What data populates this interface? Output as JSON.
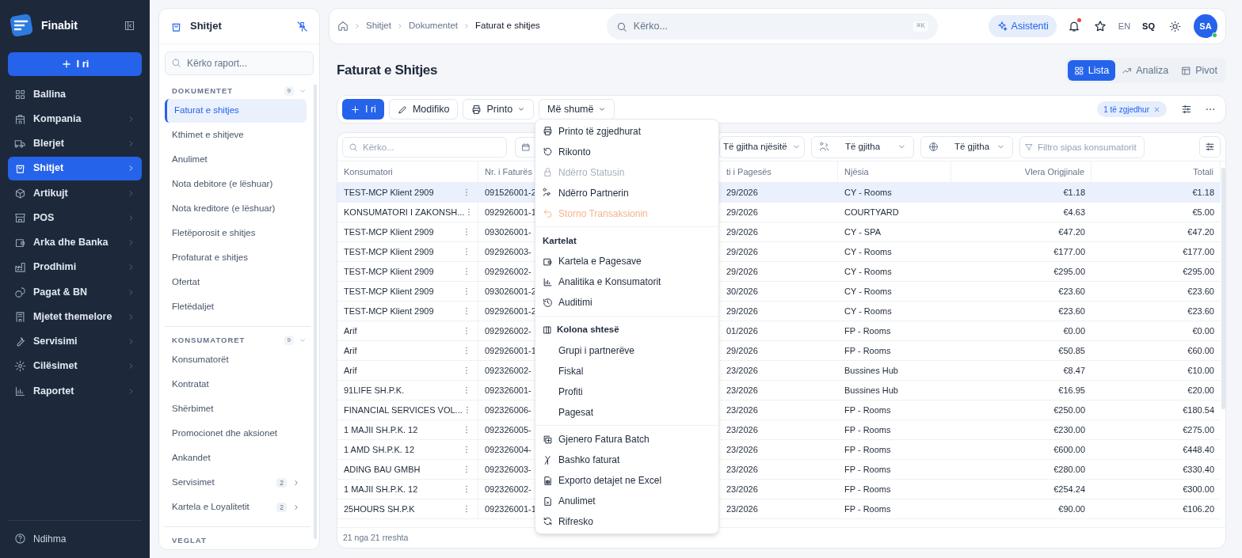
{
  "app": {
    "name": "Finabit",
    "new_button": "I ri",
    "help": "Ndihma"
  },
  "sidebar": {
    "items": [
      {
        "label": "Ballina",
        "has_children": false,
        "selected": false
      },
      {
        "label": "Kompania",
        "has_children": true,
        "selected": false
      },
      {
        "label": "Blerjet",
        "has_children": true,
        "selected": false
      },
      {
        "label": "Shitjet",
        "has_children": true,
        "selected": true
      },
      {
        "label": "Artikujt",
        "has_children": true,
        "selected": false
      },
      {
        "label": "POS",
        "has_children": true,
        "selected": false
      },
      {
        "label": "Arka dhe Banka",
        "has_children": true,
        "selected": false
      },
      {
        "label": "Prodhimi",
        "has_children": true,
        "selected": false
      },
      {
        "label": "Pagat & BN",
        "has_children": true,
        "selected": false
      },
      {
        "label": "Mjetet themelore",
        "has_children": true,
        "selected": false
      },
      {
        "label": "Servisimi",
        "has_children": true,
        "selected": false
      },
      {
        "label": "Cilësimet",
        "has_children": true,
        "selected": false
      },
      {
        "label": "Raportet",
        "has_children": true,
        "selected": false
      }
    ]
  },
  "panel": {
    "title": "Shitjet",
    "search": {
      "placeholder": "Kërko raport..."
    },
    "sections": [
      {
        "title": "DOKUMENTET",
        "count": "9",
        "expanded": true,
        "items": [
          {
            "label": "Faturat e shitjes",
            "selected": true
          },
          {
            "label": "Kthimet e shitjeve",
            "selected": false
          },
          {
            "label": "Anulimet",
            "selected": false
          },
          {
            "label": "Nota debitore (e lëshuar)",
            "selected": false
          },
          {
            "label": "Nota kreditore (e lëshuar)",
            "selected": false
          },
          {
            "label": "Fletëporosit e shitjes",
            "selected": false
          },
          {
            "label": "Profaturat e shitjes",
            "selected": false
          },
          {
            "label": "Ofertat",
            "selected": false
          },
          {
            "label": "Fletëdaljet",
            "selected": false
          }
        ]
      },
      {
        "title": "KONSUMATORET",
        "count": "9",
        "expanded": true,
        "items": [
          {
            "label": "Konsumatorët",
            "selected": false
          },
          {
            "label": "Kontratat",
            "selected": false
          },
          {
            "label": "Shërbimet",
            "selected": false
          },
          {
            "label": "Promocionet dhe aksionet",
            "selected": false
          },
          {
            "label": "Ankandet",
            "selected": false
          },
          {
            "label": "Servisimet",
            "selected": false,
            "count": "2"
          },
          {
            "label": "Kartela e Loyalitetit",
            "selected": false,
            "count": "2"
          }
        ]
      },
      {
        "title": "VEGLAT"
      }
    ]
  },
  "topbar": {
    "breadcrumb": [
      "Shitjet",
      "Dokumentet",
      "Faturat e shitjes"
    ],
    "search": {
      "placeholder": "Kërko...",
      "shortcut": "⌘K"
    },
    "assistant": "Asistenti",
    "notifications_unread": true,
    "languages": [
      {
        "label": "EN",
        "selected": false
      },
      {
        "label": "SQ",
        "selected": true
      }
    ],
    "user": {
      "initials": "SA",
      "online": true
    }
  },
  "page": {
    "title": "Faturat e Shitjes",
    "views": [
      {
        "label": "Lista",
        "selected": true
      },
      {
        "label": "Analiza",
        "selected": false
      },
      {
        "label": "Pivot",
        "selected": false
      }
    ]
  },
  "toolbar": {
    "buttons": [
      {
        "label": "I ri",
        "kind": "primary"
      },
      {
        "label": "Modifiko",
        "kind": "edit"
      },
      {
        "label": "Printo",
        "kind": "print"
      },
      {
        "label": "Më shumë",
        "kind": "more"
      }
    ],
    "selection_chip": "1 të zgjedhur"
  },
  "filters": {
    "search_placeholder": "Kërko...",
    "unit": "Të gjitha njësitë",
    "group": "Të gjitha",
    "region": "Të gjitha",
    "customer_placeholder": "Filtro sipas konsumatorit"
  },
  "table": {
    "columns": [
      "Konsumatori",
      "Nr. i Faturës",
      "ti i Pagesës",
      "Njësia",
      "Vlera Origjinale",
      "Totali"
    ],
    "rows": [
      {
        "selected": true,
        "cells": [
          "TEST-MCP Klient 2909",
          "091526001-2",
          "29/2026",
          "CY - Rooms",
          "€1.18",
          "€1.18"
        ]
      },
      {
        "selected": false,
        "cells": [
          "KONSUMATORI I ZAKONSH...",
          "092926001-1",
          "29/2026",
          "COURTYARD",
          "€4.63",
          "€5.00"
        ]
      },
      {
        "selected": false,
        "cells": [
          "TEST-MCP Klient 2909",
          "093026001-",
          "29/2026",
          "CY - SPA",
          "€47.20",
          "€47.20"
        ]
      },
      {
        "selected": false,
        "cells": [
          "TEST-MCP Klient 2909",
          "092926003-",
          "29/2026",
          "CY - Rooms",
          "€177.00",
          "€177.00"
        ]
      },
      {
        "selected": false,
        "cells": [
          "TEST-MCP Klient 2909",
          "092926002-",
          "29/2026",
          "CY - Rooms",
          "€295.00",
          "€295.00"
        ]
      },
      {
        "selected": false,
        "cells": [
          "TEST-MCP Klient 2909",
          "093026001-2",
          "30/2026",
          "CY - Rooms",
          "€23.60",
          "€23.60"
        ]
      },
      {
        "selected": false,
        "cells": [
          "TEST-MCP Klient 2909",
          "092926001-2",
          "29/2026",
          "CY - Rooms",
          "€23.60",
          "€23.60"
        ]
      },
      {
        "selected": false,
        "cells": [
          "Arif",
          "092926002-",
          "01/2026",
          "FP - Rooms",
          "€0.00",
          "€0.00"
        ]
      },
      {
        "selected": false,
        "cells": [
          "Arif",
          "092926001-1",
          "29/2026",
          "FP - Rooms",
          "€50.85",
          "€60.00"
        ]
      },
      {
        "selected": false,
        "cells": [
          "Arif",
          "092326002-",
          "23/2026",
          "Bussines Hub",
          "€8.47",
          "€10.00"
        ]
      },
      {
        "selected": false,
        "cells": [
          "91LIFE SH.P.K.",
          "092326001-",
          "23/2026",
          "Bussines Hub",
          "€16.95",
          "€20.00"
        ]
      },
      {
        "selected": false,
        "cells": [
          "FINANCIAL SERVICES VOL...",
          "092326006-",
          "23/2026",
          "FP - Rooms",
          "€250.00",
          "€180.54"
        ]
      },
      {
        "selected": false,
        "cells": [
          "1 MAJII SH.P.K. 12",
          "092326005-",
          "23/2026",
          "FP - Rooms",
          "€230.00",
          "€275.00"
        ]
      },
      {
        "selected": false,
        "cells": [
          "1 AMD SH.P.K. 12",
          "092326004-",
          "23/2026",
          "FP - Rooms",
          "€600.00",
          "€448.40"
        ]
      },
      {
        "selected": false,
        "cells": [
          "ADING BAU GMBH",
          "092326003-",
          "23/2026",
          "FP - Rooms",
          "€280.00",
          "€330.40"
        ]
      },
      {
        "selected": false,
        "cells": [
          "1 MAJII SH.P.K. 12",
          "092326002-",
          "23/2026",
          "FP - Rooms",
          "€254.24",
          "€300.00"
        ]
      },
      {
        "selected": false,
        "cells": [
          "25HOURS SH.P.K",
          "092326001-1",
          "23/2026",
          "FP - Rooms",
          "€90.00",
          "€106.20"
        ]
      }
    ],
    "footer": "21 nga 21 rreshta"
  },
  "menu": {
    "groups": [
      {
        "items": [
          {
            "label": "Printo të zgjedhurat",
            "kind": "action",
            "disabled": false
          },
          {
            "label": "Rikonto",
            "kind": "action",
            "disabled": false
          },
          {
            "label": "Ndërro Statusin",
            "kind": "action",
            "disabled": true
          },
          {
            "label": "Ndërro Partnerin",
            "kind": "action",
            "disabled": false
          },
          {
            "label": "Storno Transaksionin",
            "kind": "revert",
            "disabled": true
          }
        ]
      },
      {
        "heading": "Kartelat",
        "items": [
          {
            "label": "Kartela e Pagesave",
            "kind": "action",
            "disabled": false
          },
          {
            "label": "Analitika e Konsumatorit",
            "kind": "action",
            "disabled": false
          },
          {
            "label": "Auditimi",
            "kind": "action",
            "disabled": false
          }
        ]
      },
      {
        "heading": "Kolona shtesë",
        "items": [
          {
            "label": "Grupi i partnerëve",
            "kind": "option",
            "disabled": false
          },
          {
            "label": "Fiskal",
            "kind": "option",
            "disabled": false
          },
          {
            "label": "Profiti",
            "kind": "option",
            "disabled": false
          },
          {
            "label": "Pagesat",
            "kind": "option",
            "disabled": false
          }
        ]
      },
      {
        "items": [
          {
            "label": "Gjenero Fatura Batch",
            "kind": "action",
            "disabled": false
          },
          {
            "label": "Bashko faturat",
            "kind": "action",
            "disabled": false
          },
          {
            "label": "Exporto detajet ne Excel",
            "kind": "action",
            "disabled": false
          },
          {
            "label": "Anulimet",
            "kind": "action",
            "disabled": false
          },
          {
            "label": "Rifresko",
            "kind": "action",
            "disabled": false
          }
        ]
      }
    ]
  }
}
